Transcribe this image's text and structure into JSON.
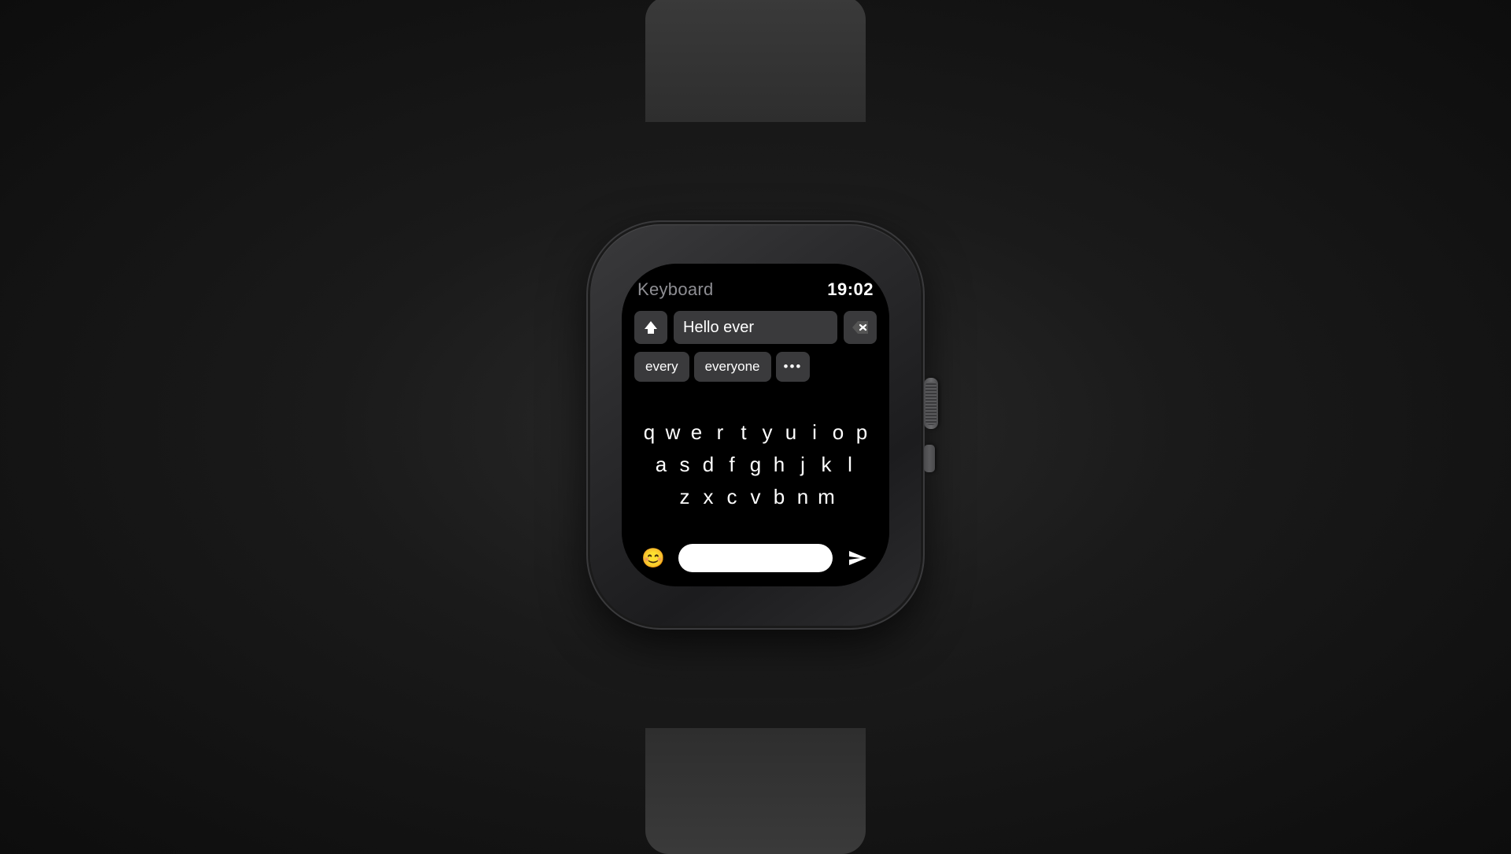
{
  "header": {
    "title": "Keyboard",
    "time": "19:02"
  },
  "text_input": {
    "content": "Hello ever",
    "shift_label": "⇧",
    "delete_label": "⌫"
  },
  "autocomplete": {
    "suggestions": [
      "every",
      "everyone",
      "..."
    ]
  },
  "keyboard": {
    "row1": [
      "q",
      "w",
      "e",
      "r",
      "t",
      "y",
      "u",
      "i",
      "o",
      "p"
    ],
    "row2": [
      "a",
      "s",
      "d",
      "f",
      "g",
      "h",
      "j",
      "k",
      "l"
    ],
    "row3": [
      "z",
      "x",
      "c",
      "v",
      "b",
      "n",
      "m"
    ]
  },
  "bottom": {
    "emoji_icon": "😊",
    "space_label": "",
    "send_icon": "➤"
  }
}
